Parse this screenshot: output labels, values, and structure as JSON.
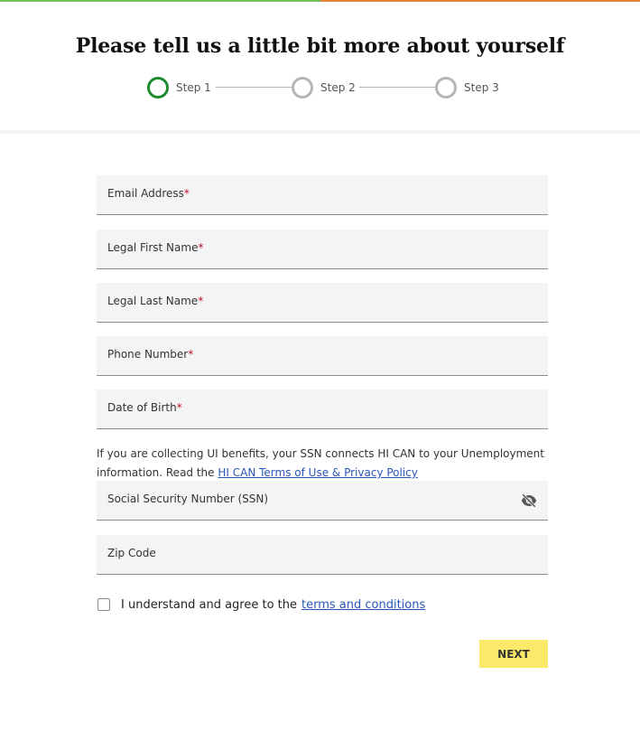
{
  "progress": {
    "fraction": 0.5,
    "fill_color": "#6fbf5a",
    "rest_color": "#e8833a"
  },
  "header": {
    "title": "Please tell us a little bit more about yourself"
  },
  "stepper": {
    "steps": [
      {
        "label": "Step 1",
        "active": true
      },
      {
        "label": "Step 2",
        "active": false
      },
      {
        "label": "Step 3",
        "active": false
      }
    ],
    "active_color": "#1e8a2e"
  },
  "form": {
    "email_label": "Email Address",
    "first_name_label": "Legal First Name",
    "last_name_label": "Legal Last Name",
    "phone_label": "Phone Number",
    "dob_label": "Date of Birth",
    "required_marker": "*",
    "ssn_note_text": "If you are collecting UI benefits, your SSN connects HI CAN to your Unemployment information. Read the ",
    "ssn_note_link": "HI CAN Terms of Use & Privacy Policy",
    "ssn_label": "Social Security Number (SSN)",
    "ssn_toggle_icon": "eye-slash-icon",
    "zip_label": "Zip Code",
    "agree_text": "I understand and agree to the",
    "agree_link": "terms and conditions",
    "next_label": "NEXT",
    "next_color": "#fce96a",
    "link_color": "#2a56b8",
    "required_color": "#c0102b"
  }
}
